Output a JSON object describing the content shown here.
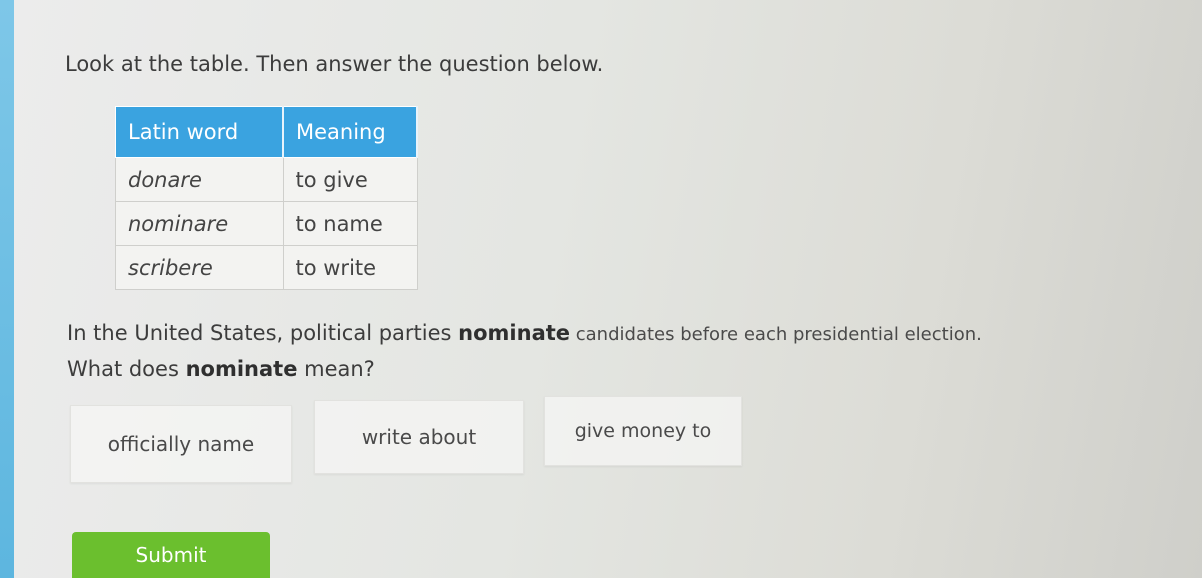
{
  "instruction": "Look at the table. Then answer the question below.",
  "table": {
    "headers": [
      "Latin word",
      "Meaning"
    ],
    "rows": [
      [
        "donare",
        "to give"
      ],
      [
        "nominare",
        "to name"
      ],
      [
        "scribere",
        "to write"
      ]
    ]
  },
  "question": {
    "line1_before": "In the United States, political parties ",
    "line1_bold": "nominate",
    "line1_after": " candidates before each presidential election.",
    "line2_before": "What does ",
    "line2_bold": "nominate",
    "line2_after": " mean?"
  },
  "choices": [
    "officially name",
    "write about",
    "give money to"
  ],
  "submit_label": "Submit",
  "colors": {
    "header_blue": "#3aa3e0",
    "submit_green": "#6bbf2e"
  }
}
